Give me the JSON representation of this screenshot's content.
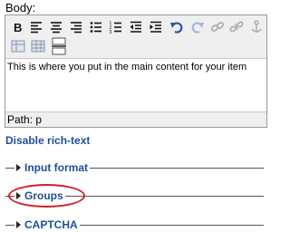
{
  "field": {
    "label": "Body:"
  },
  "editor": {
    "toolbar": {
      "row1": [
        "bold-icon",
        "align-left-icon",
        "align-center-icon",
        "align-right-icon",
        "bullet-list-icon",
        "numbered-list-icon",
        "outdent-icon",
        "indent-icon",
        "undo-icon",
        "redo-icon",
        "link-icon",
        "unlink-icon",
        "anchor-icon"
      ],
      "row2": [
        "image-icon",
        "table-icon",
        "horizontal-rule-icon"
      ]
    },
    "content": "This is where you put in the main content for your item",
    "path": "Path: p"
  },
  "links": {
    "disable_rich_text": "Disable rich-text"
  },
  "sections": {
    "input_format": "Input format",
    "groups": "Groups",
    "captcha": "CAPTCHA"
  },
  "colors": {
    "link": "#1f4e9b",
    "highlight": "#d0202a"
  }
}
